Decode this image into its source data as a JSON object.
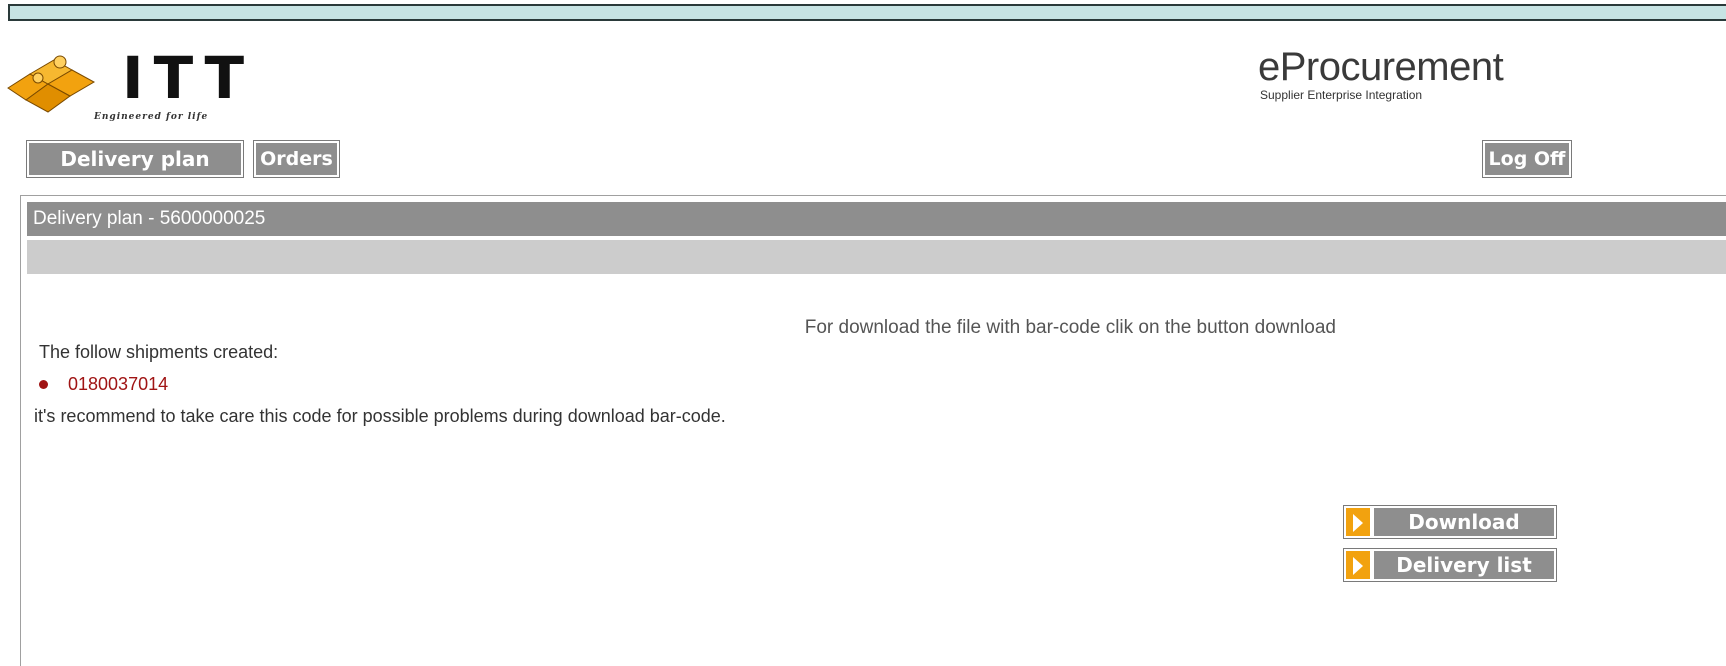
{
  "logo": {
    "text": "ITT",
    "tagline": "Engineered for life"
  },
  "brand": {
    "title": "eProcurement",
    "subtitle": "Supplier Enterprise Integration"
  },
  "nav": {
    "delivery_plan": "Delivery plan",
    "orders": "Orders",
    "log_off": "Log Off"
  },
  "panel": {
    "title": "Delivery plan - 5600000025"
  },
  "message": {
    "created": "The follow shipments created:",
    "shipment_code": "0180037014",
    "recommend": "it's recommend to take care this code for possible problems during download bar-code.",
    "download_hint": "For download the file with bar-code clik on the button download"
  },
  "actions": {
    "download": "Download",
    "delivery_list": "Delivery list"
  },
  "colors": {
    "accent_orange": "#f2a20f",
    "header_gray": "#8e8e8e",
    "code_red": "#a01414",
    "top_strip": "#c7e4e4"
  }
}
